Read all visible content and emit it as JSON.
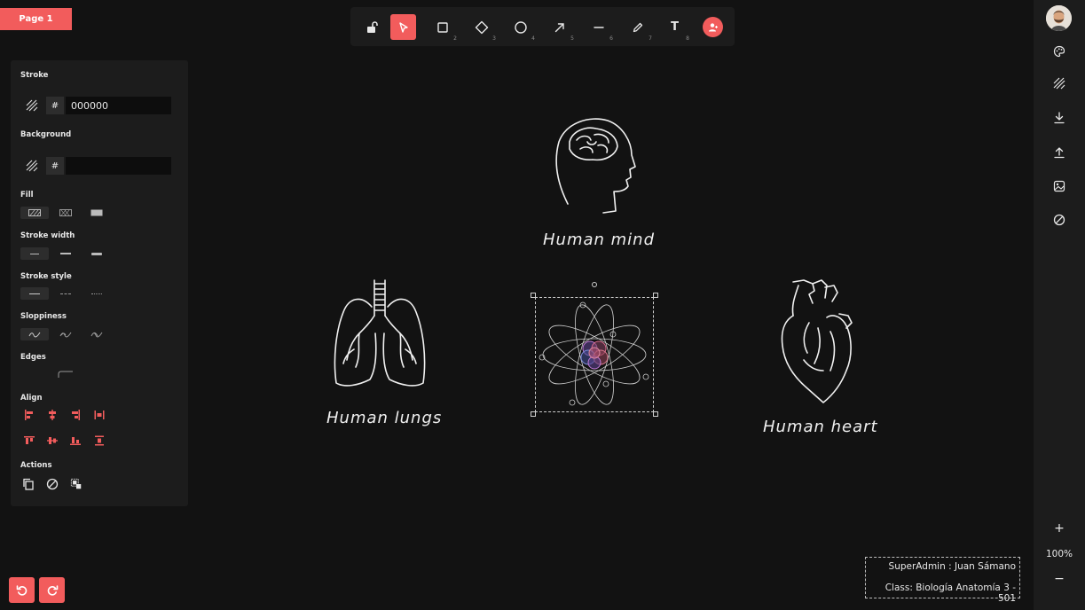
{
  "page_tab": {
    "label": "Page 1"
  },
  "toolbar": {
    "tools": [
      {
        "name": "lock",
        "num": ""
      },
      {
        "name": "select",
        "num": ""
      },
      {
        "name": "rectangle",
        "num": "2"
      },
      {
        "name": "diamond",
        "num": "3"
      },
      {
        "name": "ellipse",
        "num": "4"
      },
      {
        "name": "arrow",
        "num": "5"
      },
      {
        "name": "line",
        "num": "6"
      },
      {
        "name": "draw",
        "num": "7"
      },
      {
        "name": "text",
        "num": "8"
      }
    ],
    "text_tool_glyph": "T",
    "accent": "#f25c5c"
  },
  "panel": {
    "stroke_label": "Stroke",
    "stroke_hash": "#",
    "stroke_value": "000000",
    "background_label": "Background",
    "background_hash": "#",
    "background_value": "",
    "fill_label": "Fill",
    "stroke_width_label": "Stroke width",
    "stroke_style_label": "Stroke style",
    "sloppiness_label": "Sloppiness",
    "edges_label": "Edges",
    "align_label": "Align",
    "actions_label": "Actions"
  },
  "canvas": {
    "mind_label": "Human mind",
    "lungs_label": "Human lungs",
    "heart_label": "Human heart"
  },
  "right_bar": {
    "icons": [
      "palette-icon",
      "hatch-icon",
      "download-icon",
      "upload-icon",
      "image-icon",
      "clear-icon"
    ],
    "zoom_plus": "+",
    "zoom_level": "100%",
    "zoom_minus": "−"
  },
  "info": {
    "user_line": "SuperAdmin : Juan Sámano",
    "class_line": "Class: Biología Anatomía 3 - 501"
  }
}
